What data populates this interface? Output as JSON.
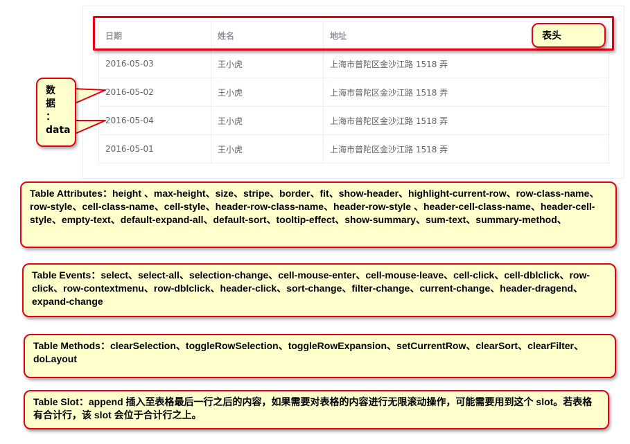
{
  "table": {
    "headers": [
      "日期",
      "姓名",
      "地址"
    ],
    "rows": [
      [
        "2016-05-03",
        "王小虎",
        "上海市普陀区金沙江路 1518 弄"
      ],
      [
        "2016-05-02",
        "王小虎",
        "上海市普陀区金沙江路 1518 弄"
      ],
      [
        "2016-05-04",
        "王小虎",
        "上海市普陀区金沙江路 1518 弄"
      ],
      [
        "2016-05-01",
        "王小虎",
        "上海市普陀区金沙江路 1518 弄"
      ]
    ]
  },
  "callouts": {
    "header": "表头",
    "data": "数\n据\n：\ndata"
  },
  "info_boxes": {
    "attributes": "Table Attributes：height 、max-height、size、stripe、border、fit、show-header、highlight-current-row、row-class-name、row-style、cell-class-name、cell-style、header-row-class-name、header-row-style 、header-cell-class-name、header-cell-style、empty-text、default-expand-all、default-sort、tooltip-effect、show-summary、sum-text、summary-method、",
    "events": "Table Events：select、select-all、selection-change、cell-mouse-enter、cell-mouse-leave、cell-click、cell-dblclick、row-click、row-contextmenu、row-dblclick、header-click、sort-change、filter-change、current-change、header-dragend、expand-change",
    "methods": "Table Methods：clearSelection、toggleRowSelection、toggleRowExpansion、setCurrentRow、clearSort、clearFilter、doLayout",
    "slot": "Table Slot：append 插入至表格最后一行之后的内容，如果需要对表格的内容进行无限滚动操作，可能需要用到这个 slot。若表格有合计行，该 slot 会位于合计行之上。"
  },
  "colors": {
    "accent_red": "#e60012",
    "callout_fill": "#ffffcc",
    "table_border": "#ebeef5"
  }
}
